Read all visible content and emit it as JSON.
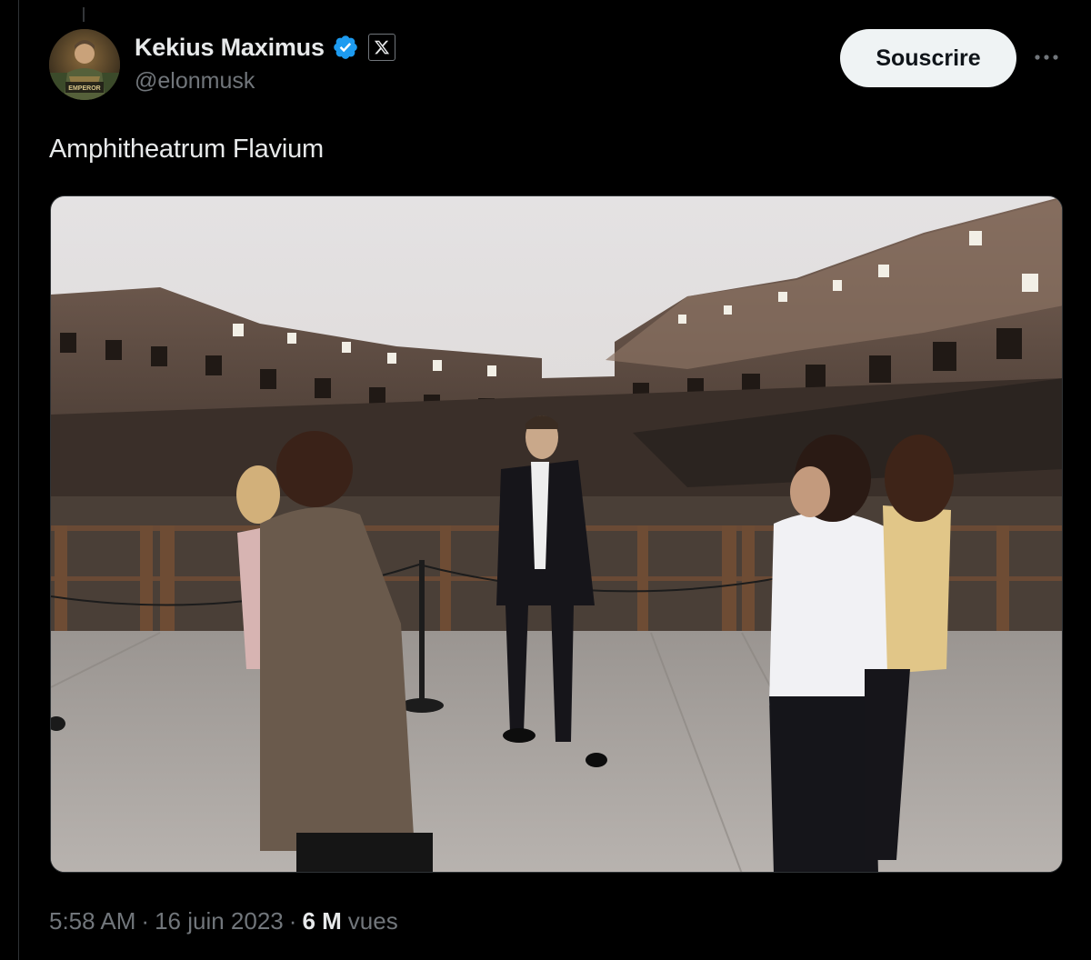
{
  "tweet": {
    "author": {
      "display_name": "Kekius Maximus",
      "handle": "@elonmusk",
      "verified_icon": "verified-badge-icon",
      "affiliation_icon": "x-logo-icon",
      "avatar_caption": "EMPEROR"
    },
    "subscribe_label": "Souscrire",
    "more_icon": "more-horizontal-icon",
    "text": "Amphitheatrum Flavium",
    "media": {
      "type": "photo",
      "subject": "colosseum-interior-photo"
    },
    "meta": {
      "time": "5:58 AM",
      "separator": "·",
      "date": "16 juin 2023",
      "views_count": "6 M",
      "views_label": "vues"
    }
  },
  "colors": {
    "background": "#000000",
    "primary_text": "#e7e9ea",
    "secondary_text": "#71767b",
    "verified_blue": "#1d9bf0",
    "button_bg": "#eff3f4",
    "button_text": "#0f1419"
  }
}
